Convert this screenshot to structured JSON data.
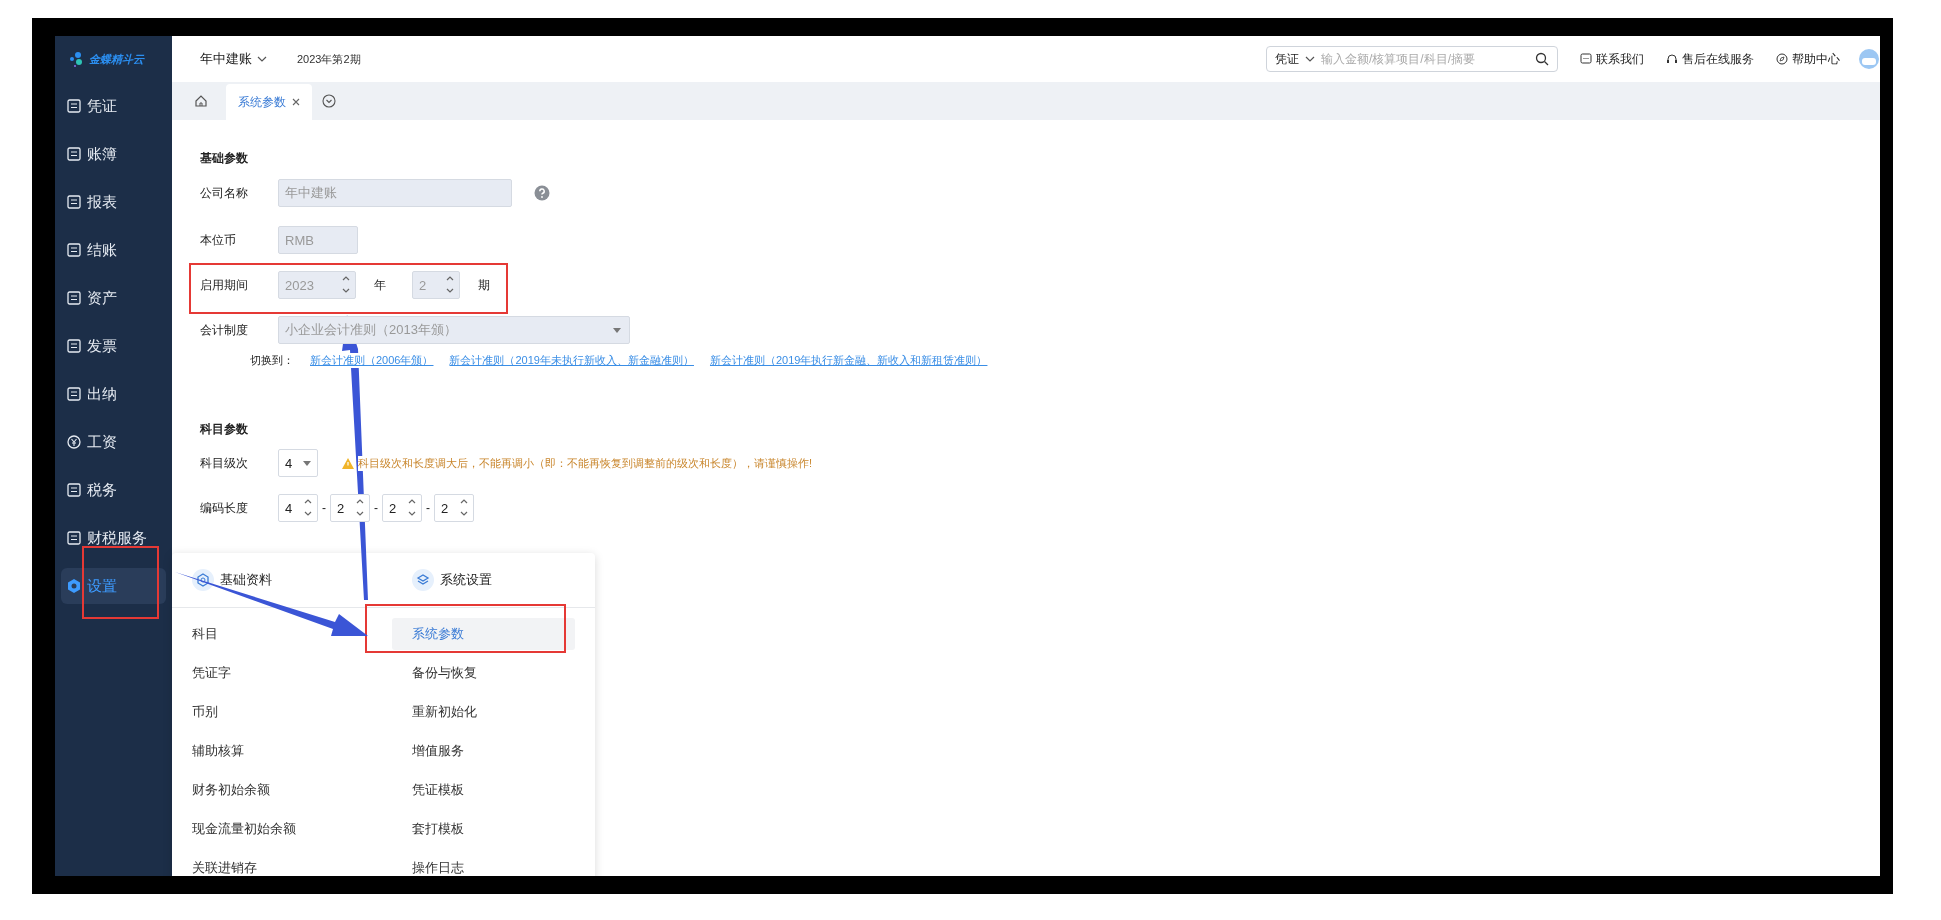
{
  "logo": "金蝶精斗云",
  "sidebar": {
    "items": [
      {
        "label": "凭证",
        "selected": false
      },
      {
        "label": "账簿",
        "selected": false
      },
      {
        "label": "报表",
        "selected": false
      },
      {
        "label": "结账",
        "selected": false
      },
      {
        "label": "资产",
        "selected": false
      },
      {
        "label": "发票",
        "selected": false
      },
      {
        "label": "出纳",
        "selected": false
      },
      {
        "label": "工资",
        "selected": false
      },
      {
        "label": "税务",
        "selected": false
      },
      {
        "label": "财税服务",
        "selected": false
      },
      {
        "label": "设置",
        "selected": true
      }
    ]
  },
  "header": {
    "book": "年中建账",
    "period": "2023年第2期",
    "search": {
      "scope": "凭证",
      "placeholder": "输入金额/核算项目/科目/摘要"
    },
    "links": [
      "联系我们",
      "售后在线服务",
      "帮助中心"
    ]
  },
  "tabs": [
    {
      "label": "系统参数",
      "selected": true
    }
  ],
  "basic": {
    "title": "基础参数",
    "company": {
      "label": "公司名称",
      "value": "年中建账",
      "disabled": true
    },
    "currency": {
      "label": "本位币",
      "value": "RMB",
      "disabled": true
    },
    "start": {
      "label": "启用期间",
      "year": "2023",
      "year_unit": "年",
      "period": "2",
      "period_unit": "期",
      "disabled": true
    },
    "system": {
      "label": "会计制度",
      "value": "小企业会计准则（2013年颁）",
      "disabled": true
    },
    "switch": {
      "label": "切换到：",
      "links": [
        "新会计准则（2006年颁）",
        "新会计准则（2019年未执行新收入、新金融准则）",
        "新会计准则（2019年执行新金融、新收入和新租赁准则）"
      ]
    }
  },
  "subject": {
    "title": "科目参数",
    "levels": {
      "label": "科目级次",
      "value": "4",
      "disabled": false,
      "warning": "科目级次和长度调大后，不能再调小（即：不能再恢复到调整前的级次和长度），请谨慎操作!"
    },
    "code_length": {
      "label": "编码长度",
      "parts": [
        "4",
        "2",
        "2",
        "2"
      ],
      "separators": [
        "-",
        "-",
        "-"
      ],
      "disabled": false
    }
  },
  "menu": {
    "columns": [
      {
        "title": "基础资料",
        "items": [
          {
            "label": "科目",
            "selected": false
          },
          {
            "label": "凭证字",
            "selected": false
          },
          {
            "label": "币别",
            "selected": false
          },
          {
            "label": "辅助核算",
            "selected": false
          },
          {
            "label": "财务初始余额",
            "selected": false
          },
          {
            "label": "现金流量初始余额",
            "selected": false
          },
          {
            "label": "关联进销存",
            "selected": false
          }
        ]
      },
      {
        "title": "系统设置",
        "items": [
          {
            "label": "系统参数",
            "selected": true
          },
          {
            "label": "备份与恢复",
            "selected": false
          },
          {
            "label": "重新初始化",
            "selected": false
          },
          {
            "label": "增值服务",
            "selected": false
          },
          {
            "label": "凭证模板",
            "selected": false
          },
          {
            "label": "套打模板",
            "selected": false
          },
          {
            "label": "操作日志",
            "selected": false
          }
        ]
      }
    ]
  }
}
